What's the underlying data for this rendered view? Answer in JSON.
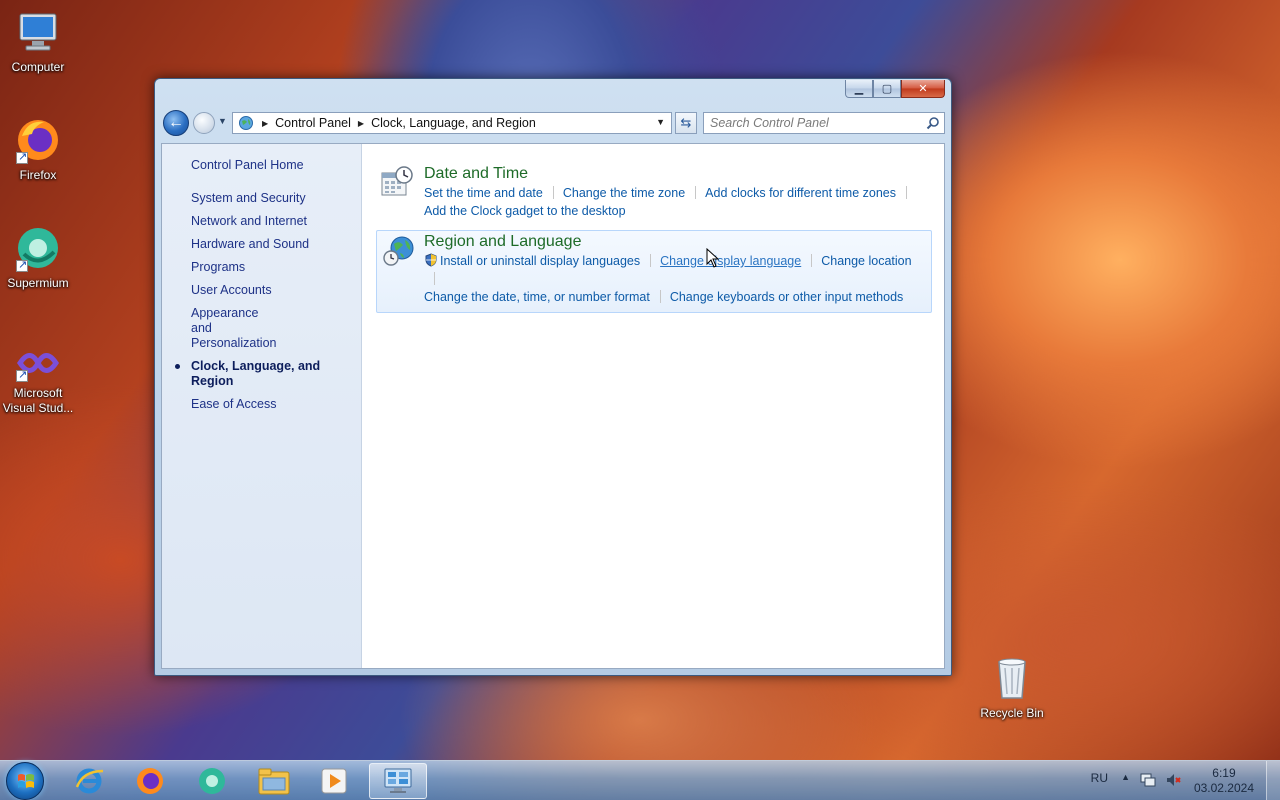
{
  "desktop": {
    "icons": [
      {
        "label": "Computer",
        "icon": "computer-icon"
      },
      {
        "label": "Firefox",
        "icon": "firefox-icon"
      },
      {
        "label": "Supermium",
        "icon": "supermium-icon"
      },
      {
        "label": "Microsoft Visual Stud...",
        "icon": "visual-studio-icon"
      },
      {
        "label": "Recycle Bin",
        "icon": "recycle-bin-icon"
      }
    ]
  },
  "window": {
    "address": {
      "segments": [
        "Control Panel",
        "Clock, Language, and Region"
      ]
    },
    "search": {
      "placeholder": "Search Control Panel"
    },
    "sidebar": {
      "home": "Control Panel Home",
      "items": [
        {
          "label": "System and Security"
        },
        {
          "label": "Network and Internet"
        },
        {
          "label": "Hardware and Sound"
        },
        {
          "label": "Programs"
        },
        {
          "label": "User Accounts"
        },
        {
          "label": "Appearance and Personalization"
        },
        {
          "label": "Clock, Language, and Region",
          "active": true
        },
        {
          "label": "Ease of Access"
        }
      ]
    },
    "categories": [
      {
        "title": "Date and Time",
        "icon": "date-time-icon",
        "links": [
          "Set the time and date",
          "Change the time zone",
          "Add clocks for different time zones",
          "Add the Clock gadget to the desktop"
        ]
      },
      {
        "title": "Region and Language",
        "icon": "globe-icon",
        "links": [
          "Install or uninstall display languages",
          "Change display language",
          "Change location",
          "Change the date, time, or number format",
          "Change keyboards or other input methods"
        ]
      }
    ]
  },
  "taskbar": {
    "pinned": [
      "internet-explorer-icon",
      "firefox-icon",
      "supermium-icon",
      "explorer-icon",
      "media-player-icon",
      "control-panel-icon"
    ],
    "tray": {
      "language": "RU",
      "time": "6:19",
      "date": "03.02.2024"
    }
  },
  "colors": {
    "link": "#0e5ba8",
    "category_title": "#1e6b28",
    "sidebar_text": "#1e3287"
  }
}
